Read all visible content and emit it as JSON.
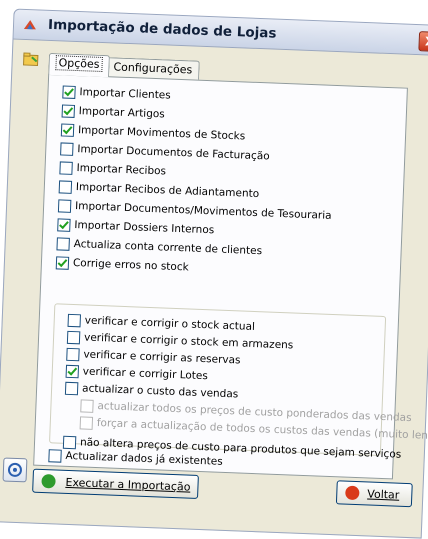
{
  "window": {
    "title": "Importação de dados de Lojas",
    "close_label": "X"
  },
  "tabs": [
    {
      "label": "Opções",
      "active": true
    },
    {
      "label": "Configurações",
      "active": false
    }
  ],
  "options": [
    {
      "label": "Importar Clientes",
      "checked": true
    },
    {
      "label": "Importar Artigos",
      "checked": true
    },
    {
      "label": "Importar Movimentos de Stocks",
      "checked": true
    },
    {
      "label": "Importar Documentos de Facturação",
      "checked": false
    },
    {
      "label": "Importar Recibos",
      "checked": false
    },
    {
      "label": "Importar Recibos de Adiantamento",
      "checked": false
    },
    {
      "label": "Importar Documentos/Movimentos de Tesouraria",
      "checked": false
    },
    {
      "label": "Importar Dossiers Internos",
      "checked": true
    },
    {
      "label": "Actualiza conta corrente de clientes",
      "checked": false
    },
    {
      "label": "Corrige erros no stock",
      "checked": true
    }
  ],
  "stock_options": [
    {
      "label": "verificar e corrigir o stock actual",
      "checked": false,
      "indent": 0,
      "disabled": false
    },
    {
      "label": "verificar e corrigir o stock em armazens",
      "checked": false,
      "indent": 0,
      "disabled": false
    },
    {
      "label": "verificar e corrigir as reservas",
      "checked": false,
      "indent": 0,
      "disabled": false
    },
    {
      "label": "verificar e corrigir Lotes",
      "checked": true,
      "indent": 0,
      "disabled": false
    },
    {
      "label": "actualizar o custo das vendas",
      "checked": false,
      "indent": 0,
      "disabled": false
    },
    {
      "label": "actualizar todos os preços de custo ponderados das vendas",
      "checked": false,
      "indent": 1,
      "disabled": true
    },
    {
      "label": "forçar a actualização de todos os custos das vendas (muito lento)",
      "checked": false,
      "indent": 1,
      "disabled": true
    },
    {
      "label": "não altera preços de custo para produtos que sejam serviços",
      "checked": false,
      "indent": 0,
      "disabled": false
    }
  ],
  "update_existing": {
    "label": "Actualizar dados já existentes",
    "checked": false
  },
  "buttons": {
    "execute_label": "Executar a Importação",
    "back_label": "Voltar"
  },
  "colors": {
    "execute_icon": "#2e9b2e",
    "back_icon": "#d93a1a"
  }
}
